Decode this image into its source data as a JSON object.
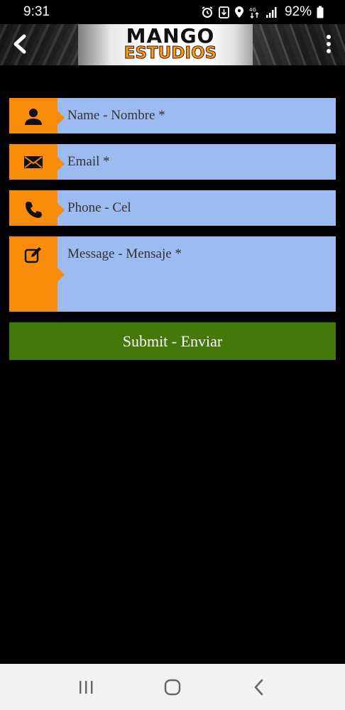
{
  "status_bar": {
    "time": "9:31",
    "battery": "92%",
    "icons": [
      "alarm-icon",
      "download-icon",
      "location-icon",
      "data-icon",
      "signal-icon",
      "battery-icon"
    ]
  },
  "header": {
    "logo_top": "MANGO",
    "logo_bottom": "ESTUDIOS",
    "back_icon": "chevron-left-icon",
    "menu_icon": "more-vertical-icon"
  },
  "form": {
    "name_placeholder": "Name - Nombre *",
    "email_placeholder": "Email *",
    "phone_placeholder": "Phone - Cel",
    "message_placeholder": "Message - Mensaje *",
    "submit_label": "Submit - Enviar",
    "icons": [
      "user-icon",
      "envelope-icon",
      "phone-icon",
      "edit-icon"
    ]
  },
  "colors": {
    "accent": "#f98c0b",
    "field_bg": "#9cbcf1",
    "submit_bg": "#43780a",
    "background": "#000000"
  },
  "nav_bar": {
    "icons": [
      "recent-apps-icon",
      "home-icon",
      "back-icon"
    ]
  }
}
